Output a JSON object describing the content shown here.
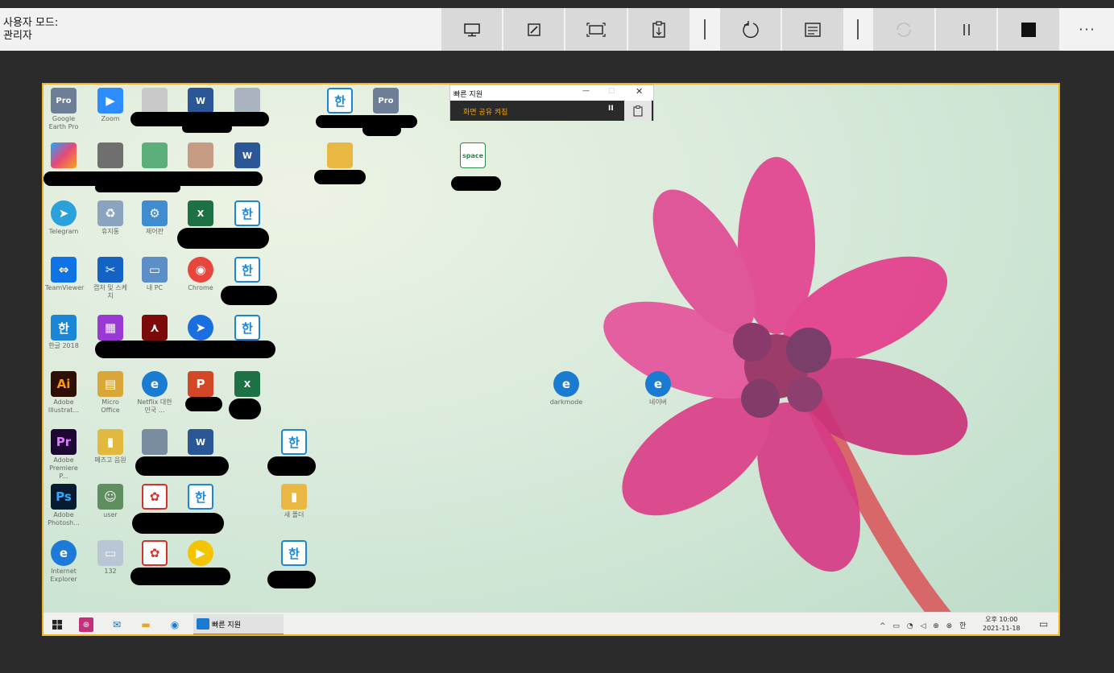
{
  "toolbar": {
    "mode_line1": "사용자 모드:",
    "mode_line2": "관리자",
    "buttons": [
      {
        "name": "select-monitor",
        "icon": "monitor-icon"
      },
      {
        "name": "annotate",
        "icon": "pencil-icon"
      },
      {
        "name": "actual-size",
        "icon": "fit-screen-icon"
      },
      {
        "name": "toggle-instruction-channel",
        "icon": "clipboard-icon"
      },
      {
        "name": "restart",
        "icon": "restart-icon"
      },
      {
        "name": "task-manager",
        "icon": "task-manager-icon"
      },
      {
        "name": "reconnect",
        "icon": "reconnect-icon",
        "disabled": true
      },
      {
        "name": "pause",
        "icon": "pause-icon"
      },
      {
        "name": "end",
        "icon": "stop-icon"
      }
    ],
    "more_label": "···"
  },
  "quick_assist": {
    "title": "빠른 지원",
    "minimize": "—",
    "maximize": "□",
    "close": "✕",
    "status": "화면 공유 켜짐",
    "pause": "II"
  },
  "desktop_icons": [
    {
      "label": "Google Earth Pro",
      "color": "#6d7f96",
      "glyph": "Pro"
    },
    {
      "label": "Zoom",
      "color": "#2d8cff",
      "glyph": "▶"
    },
    {
      "label": "Telegram",
      "color": "#2aa1da",
      "glyph": "➤"
    },
    {
      "label": "휴지통",
      "color": "#8aa4c0",
      "glyph": "♻"
    },
    {
      "label": "제어판",
      "color": "#3f8dd0",
      "glyph": "⚙"
    },
    {
      "label": "TeamViewer",
      "color": "#0e74e6",
      "glyph": "⇔"
    },
    {
      "label": "캡처 및 스케치",
      "color": "#1463c4",
      "glyph": "✂"
    },
    {
      "label": "내 PC",
      "color": "#5c8fc8",
      "glyph": "▭"
    },
    {
      "label": "Chrome",
      "color": "#e8453c",
      "glyph": "◉"
    },
    {
      "label": "한글 2018",
      "color": "#1b86d6",
      "glyph": "한"
    },
    {
      "label": "Adobe Illustrat...",
      "color": "#2f0e05",
      "glyph": "Ai"
    },
    {
      "label": "Micro Office",
      "color": "#d9a638",
      "glyph": "▤"
    },
    {
      "label": "Netflix 대한민국 ...",
      "color": "#1a7bd2",
      "glyph": "e"
    },
    {
      "label": "Adobe Premiere P...",
      "color": "#1f0735",
      "glyph": "Pr"
    },
    {
      "label": "페즈고 음원",
      "color": "#e3b83f",
      "glyph": "▮"
    },
    {
      "label": "Adobe Photosh...",
      "color": "#061c33",
      "glyph": "Ps"
    },
    {
      "label": "user",
      "color": "#5f8f5f",
      "glyph": "☺"
    },
    {
      "label": "새 폴더",
      "color": "#e8b842",
      "glyph": "▮"
    },
    {
      "label": "Internet Explorer",
      "color": "#1e7ad9",
      "glyph": "e"
    },
    {
      "label": "132",
      "color": "#b8c6d5",
      "glyph": "▭"
    },
    {
      "label": "darkmode",
      "color": "#1a7bd2",
      "glyph": "e"
    },
    {
      "label": "네이버",
      "color": "#1a7bd2",
      "glyph": "e"
    }
  ],
  "taskbar": {
    "app_label": "빠른 지원",
    "tray": "^ ▭ ◔ ◁ ⊕ ⊗ 한",
    "clock_time": "오후 10:00",
    "clock_date": "2021-11-18"
  }
}
